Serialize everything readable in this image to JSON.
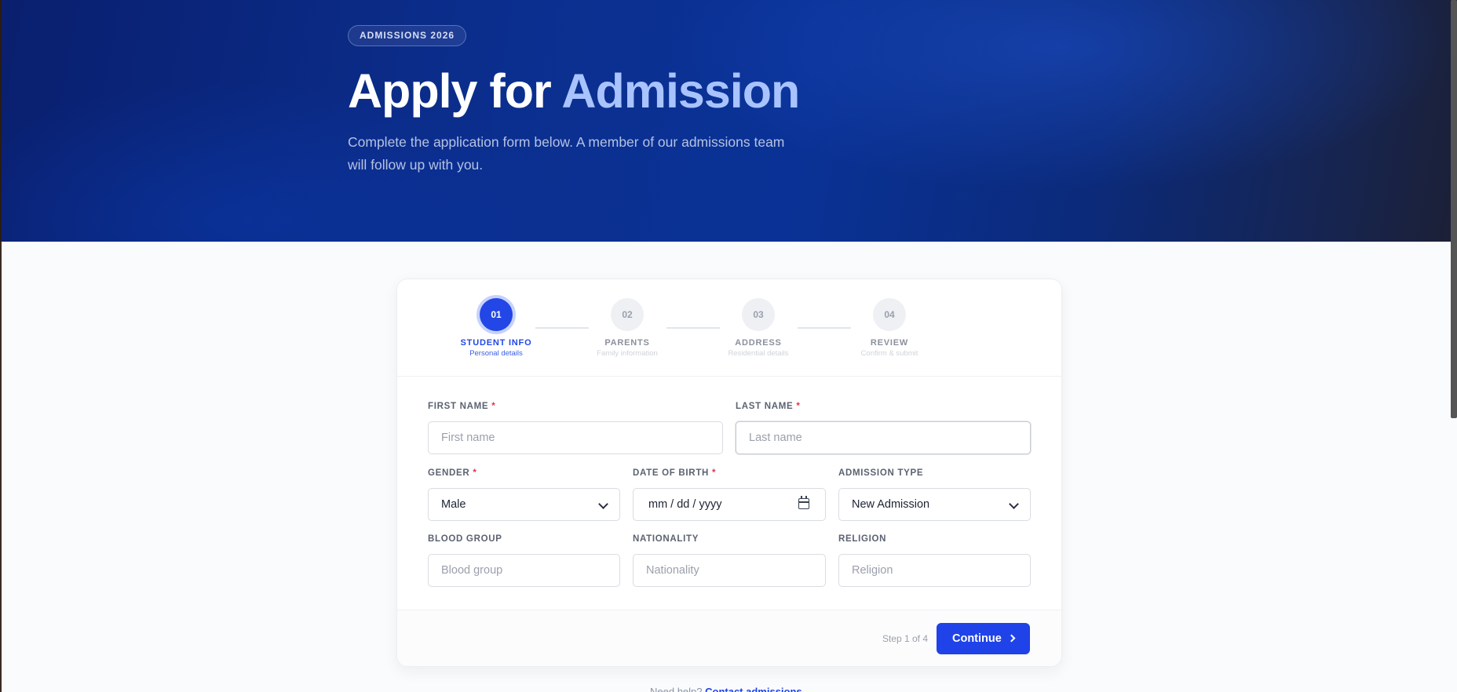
{
  "hero": {
    "badge": "ADMISSIONS 2026",
    "title_main": "Apply for ",
    "title_accent": "Admission",
    "subtitle": "Complete the application form below. A member of our admissions team will follow up with you."
  },
  "stepper": {
    "steps": [
      {
        "number": "01",
        "label": "STUDENT INFO",
        "desc": "Personal details",
        "active": true
      },
      {
        "number": "02",
        "label": "PARENTS",
        "desc": "Family information",
        "active": false
      },
      {
        "number": "03",
        "label": "ADDRESS",
        "desc": "Residential details",
        "active": false
      },
      {
        "number": "04",
        "label": "REVIEW",
        "desc": "Confirm & submit",
        "active": false
      }
    ]
  },
  "form": {
    "first_name": {
      "label": "FIRST NAME",
      "placeholder": "First name",
      "required": true
    },
    "last_name": {
      "label": "LAST NAME",
      "placeholder": "Last name",
      "required": true
    },
    "gender": {
      "label": "GENDER",
      "value": "Male",
      "required": true
    },
    "dob": {
      "label": "DATE OF BIRTH",
      "value": "mm / dd / yyyy",
      "required": true
    },
    "admission_type": {
      "label": "ADMISSION TYPE",
      "value": "New Admission"
    },
    "blood_group": {
      "label": "BLOOD GROUP",
      "placeholder": "Blood group"
    },
    "nationality": {
      "label": "NATIONALITY",
      "placeholder": "Nationality"
    },
    "religion": {
      "label": "RELIGION",
      "placeholder": "Religion"
    },
    "required_mark": "*"
  },
  "footer": {
    "step_count": "Step 1 of 4",
    "continue_label": "Continue"
  },
  "bottom": {
    "question": "Need help?",
    "link": "Contact admissions"
  },
  "colors": {
    "accent": "#1f43e8",
    "hero_dark": "#0a1f6e",
    "required": "#e0344a"
  }
}
